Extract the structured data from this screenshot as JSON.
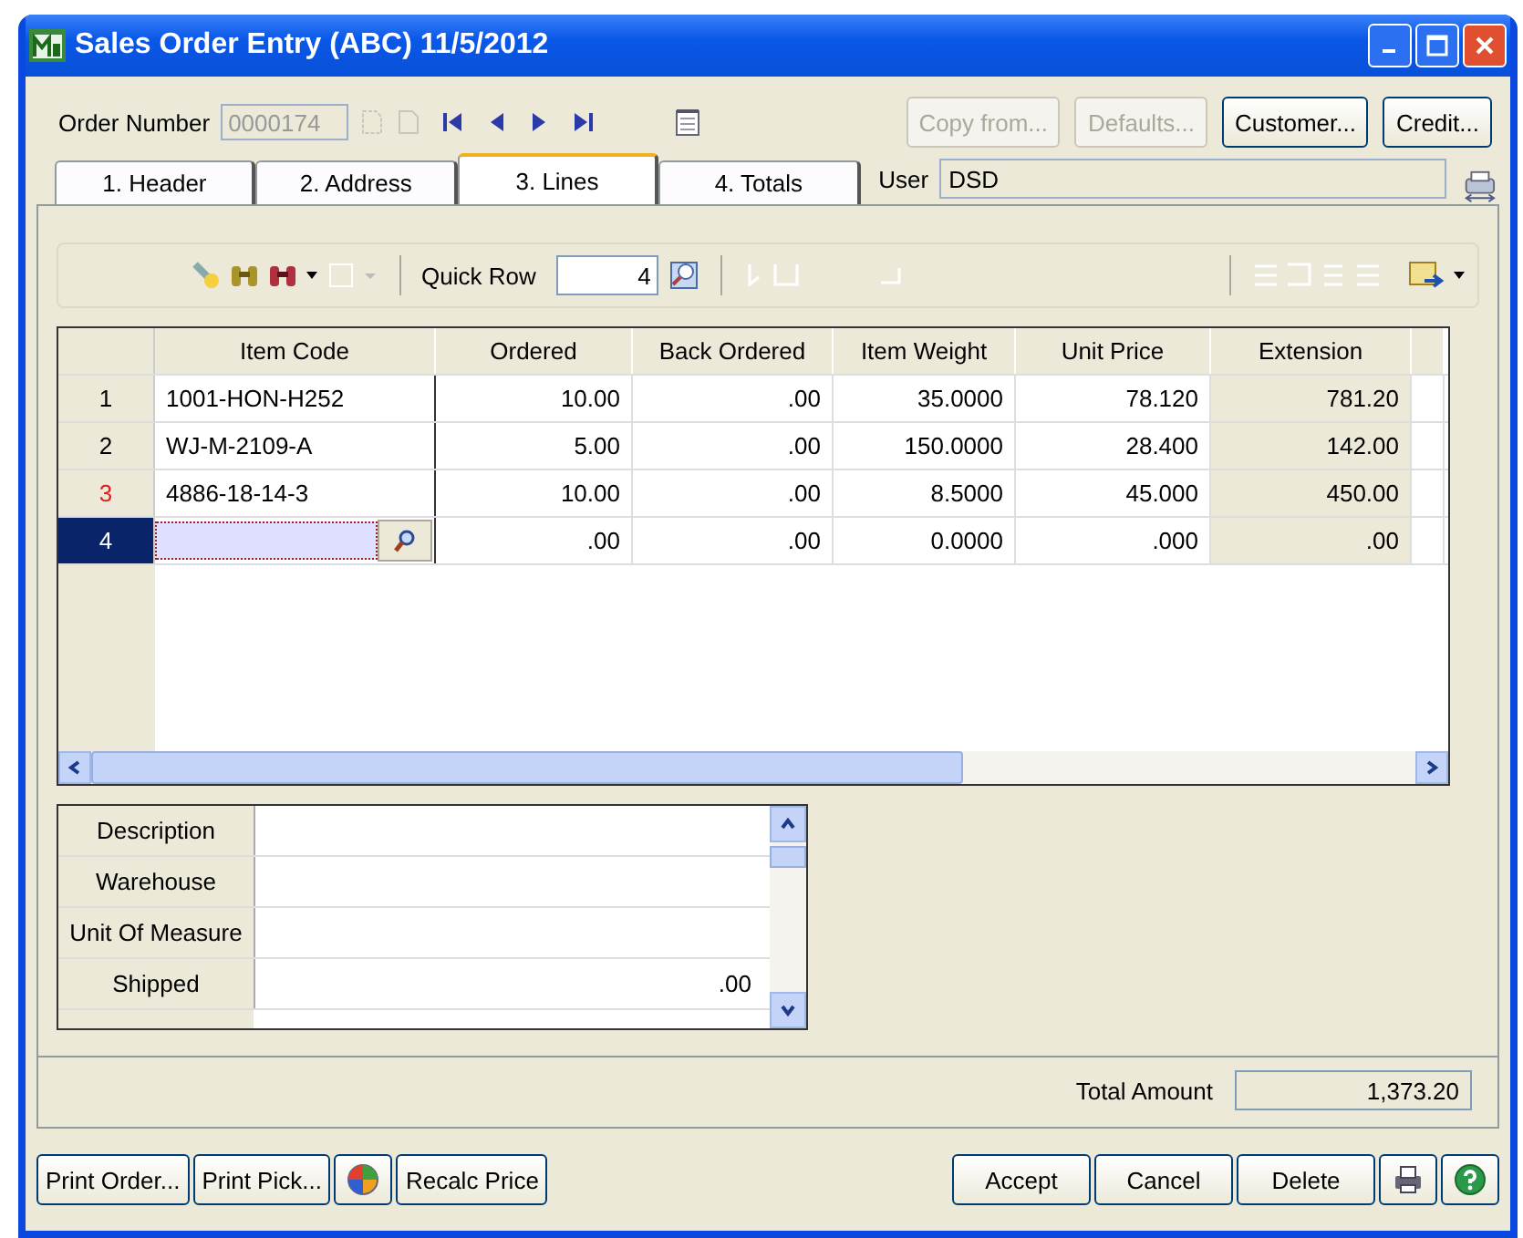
{
  "window": {
    "title": "Sales Order Entry (ABC) 11/5/2012"
  },
  "order": {
    "label": "Order Number",
    "value": "0000174"
  },
  "header_buttons": [
    {
      "label": "Copy from...",
      "disabled": true
    },
    {
      "label": "Defaults...",
      "disabled": true
    },
    {
      "label": "Customer...",
      "disabled": false
    },
    {
      "label": "Credit...",
      "disabled": false
    }
  ],
  "tabs": [
    {
      "label": "1. Header",
      "selected": false
    },
    {
      "label": "2. Address",
      "selected": false
    },
    {
      "label": "3. Lines",
      "selected": true
    },
    {
      "label": "4. Totals",
      "selected": false
    }
  ],
  "user": {
    "label": "User",
    "value": "DSD"
  },
  "toolbar": {
    "quick_row_label": "Quick Row",
    "quick_row_value": "4"
  },
  "grid": {
    "columns": [
      {
        "label": "Item Code",
        "readonly": false
      },
      {
        "label": "Ordered",
        "readonly": false
      },
      {
        "label": "Back Ordered",
        "readonly": false
      },
      {
        "label": "Item Weight",
        "readonly": false
      },
      {
        "label": "Unit Price",
        "readonly": false
      },
      {
        "label": "Extension",
        "readonly": true
      }
    ],
    "rows": [
      {
        "number": "1",
        "flagged": false,
        "selected": false,
        "cells": [
          "1001-HON-H252",
          "10.00",
          ".00",
          "35.0000",
          "78.120",
          "781.20"
        ]
      },
      {
        "number": "2",
        "flagged": false,
        "selected": false,
        "cells": [
          "WJ-M-2109-A",
          "5.00",
          ".00",
          "150.0000",
          "28.400",
          "142.00"
        ]
      },
      {
        "number": "3",
        "flagged": true,
        "selected": false,
        "cells": [
          "4886-18-14-3",
          "10.00",
          ".00",
          "8.5000",
          "45.000",
          "450.00"
        ]
      },
      {
        "number": "4",
        "flagged": false,
        "selected": true,
        "cells": [
          "",
          ".00",
          ".00",
          "0.0000",
          ".000",
          ".00"
        ]
      }
    ]
  },
  "details": [
    {
      "label": "Description"
    },
    {
      "label": "Warehouse"
    },
    {
      "label": "Unit Of Measure"
    },
    {
      "label": "Shipped",
      "value": ".00"
    }
  ],
  "total": {
    "label": "Total Amount",
    "value": "1,373.20"
  },
  "footer_left": [
    {
      "kind": "text",
      "label": "Print Order..."
    },
    {
      "kind": "text",
      "label": "Print Pick..."
    },
    {
      "kind": "globe"
    },
    {
      "kind": "text",
      "label": "Recalc Price"
    }
  ],
  "footer_right": [
    {
      "kind": "text",
      "label": "Accept"
    },
    {
      "kind": "text",
      "label": "Cancel"
    },
    {
      "kind": "text",
      "label": "Delete"
    },
    {
      "kind": "printer"
    },
    {
      "kind": "help"
    }
  ]
}
